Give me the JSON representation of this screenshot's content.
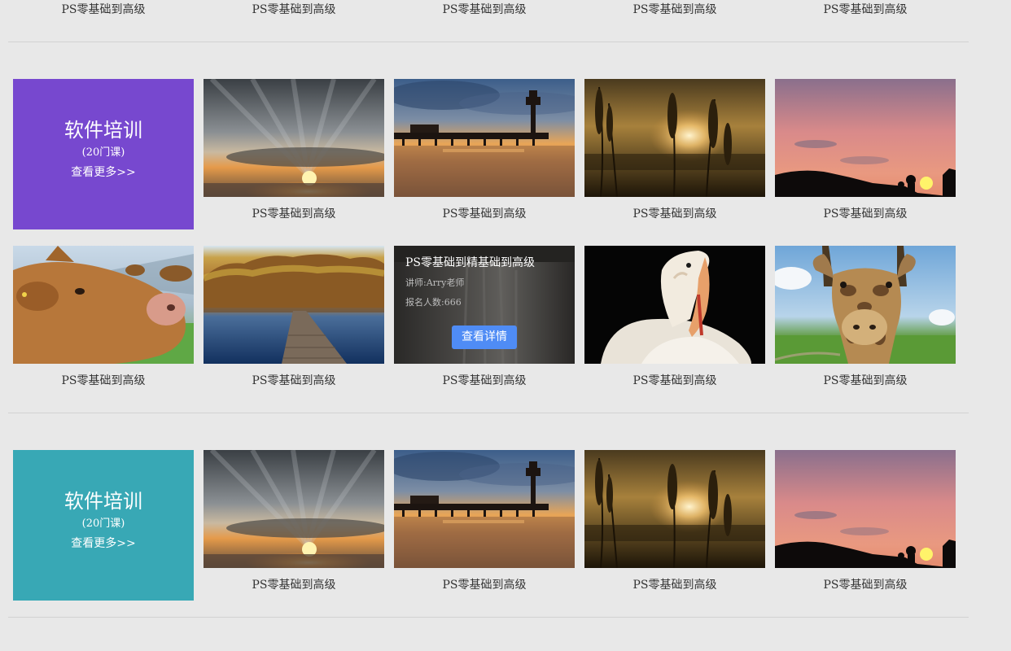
{
  "top_row": {
    "captions": [
      "PS零基础到高级",
      "PS零基础到高级",
      "PS零基础到高级",
      "PS零基础到高级",
      "PS零基础到高级"
    ]
  },
  "section1": {
    "category": {
      "title": "软件培训",
      "count": "(20门课)",
      "more": "查看更多>>",
      "color": "#7748cf"
    },
    "row1": {
      "thumb_icons": [
        "sunset-clouds-image",
        "pier-sunset-image",
        "reeds-sunset-image",
        "pink-sky-silhouette-image"
      ],
      "captions": [
        "PS零基础到高级",
        "PS零基础到高级",
        "PS零基础到高级",
        "PS零基础到高级"
      ]
    },
    "row2": {
      "thumb_icons": [
        "cow-image",
        "lake-reflection-image",
        "waterfall-image",
        "pelican-image",
        "giraffe-image"
      ],
      "captions": [
        "PS零基础到高级",
        "PS零基础到高级",
        "PS零基础到高级",
        "PS零基础到高级",
        "PS零基础到高级"
      ]
    },
    "hover_card": {
      "title": "PS零基础到精基础到高级",
      "teacher": "讲师:Arry老师",
      "enrolled": "报名人数:666",
      "button": "查看详情",
      "button_color": "#4f8cf5"
    }
  },
  "section2": {
    "category": {
      "title": "软件培训",
      "count": "(20门课)",
      "more": "查看更多>>",
      "color": "#38a8b5"
    },
    "row1": {
      "thumb_icons": [
        "sunset-clouds-image",
        "pier-sunset-image",
        "reeds-sunset-image",
        "pink-sky-silhouette-image"
      ],
      "captions": [
        "PS零基础到高级",
        "PS零基础到高级",
        "PS零基础到高级",
        "PS零基础到高级"
      ]
    }
  }
}
